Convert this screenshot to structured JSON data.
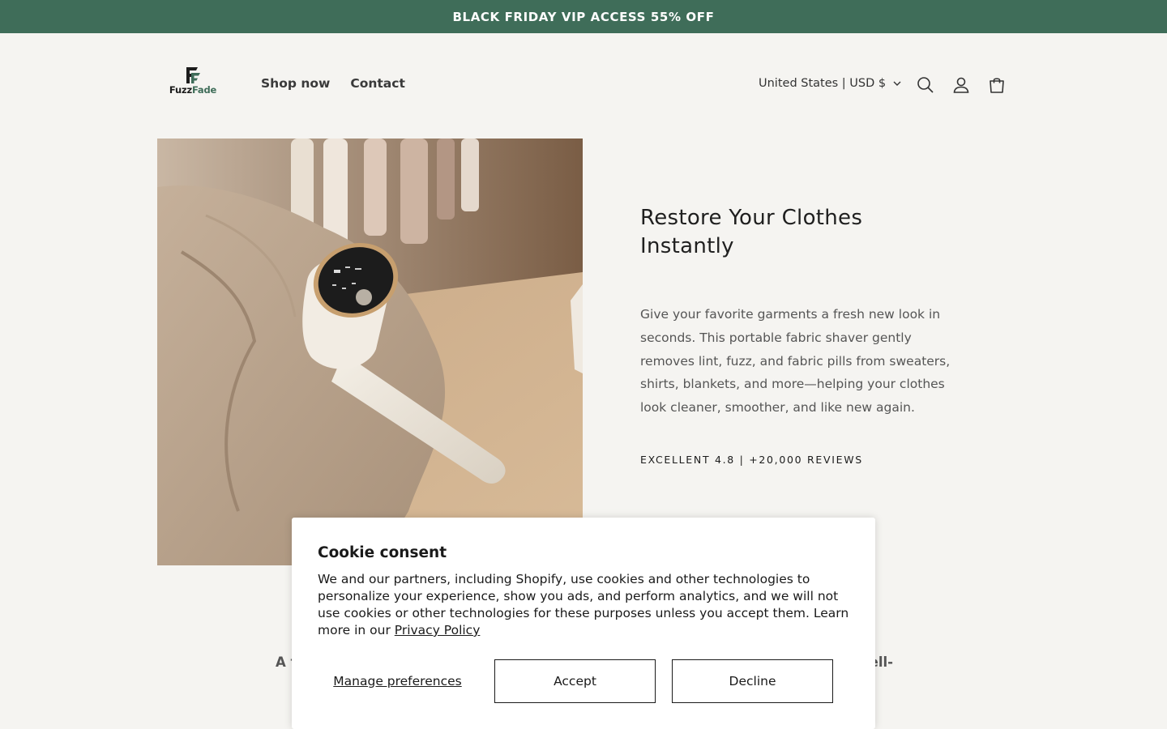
{
  "announcement": {
    "text": "BLACK FRIDAY VIP ACCESS 55% OFF"
  },
  "brand": {
    "logo_text_part1": "Fuzz",
    "logo_text_part2": "Fade",
    "logo_mark": "FF"
  },
  "nav": {
    "items": [
      {
        "label": "Shop now"
      },
      {
        "label": "Contact"
      }
    ]
  },
  "header": {
    "locale_label": "United States | USD $",
    "icons": [
      "search-icon",
      "account-icon",
      "cart-icon"
    ]
  },
  "hero": {
    "image_alt": "White fabric shaver resting on a beige wool coat",
    "title": "Restore Your Clothes Instantly",
    "description": "Give your favorite garments a fresh new look in seconds. This portable fabric shaver gently removes lint, fuzz, and fabric pills from sweaters, shirts, blankets, and more—helping your clothes look cleaner, smoother, and like new again.",
    "rating": "EXCELLENT 4.8 | +20,000 REVIEWS"
  },
  "below": {
    "left_fragment": "A f",
    "right_fragment": "ell-"
  },
  "cookie": {
    "title": "Cookie consent",
    "body": "We and our partners, including Shopify, use cookies and other technologies to personalize your experience, show you ads, and perform analytics, and we will not use cookies or other technologies for these purposes unless you accept them. Learn more in our ",
    "policy_link": "Privacy Policy",
    "manage_label": "Manage preferences",
    "accept_label": "Accept",
    "decline_label": "Decline"
  },
  "colors": {
    "accent": "#3f6d59",
    "background": "#f5f4f1",
    "text": "#1c1c1c"
  }
}
